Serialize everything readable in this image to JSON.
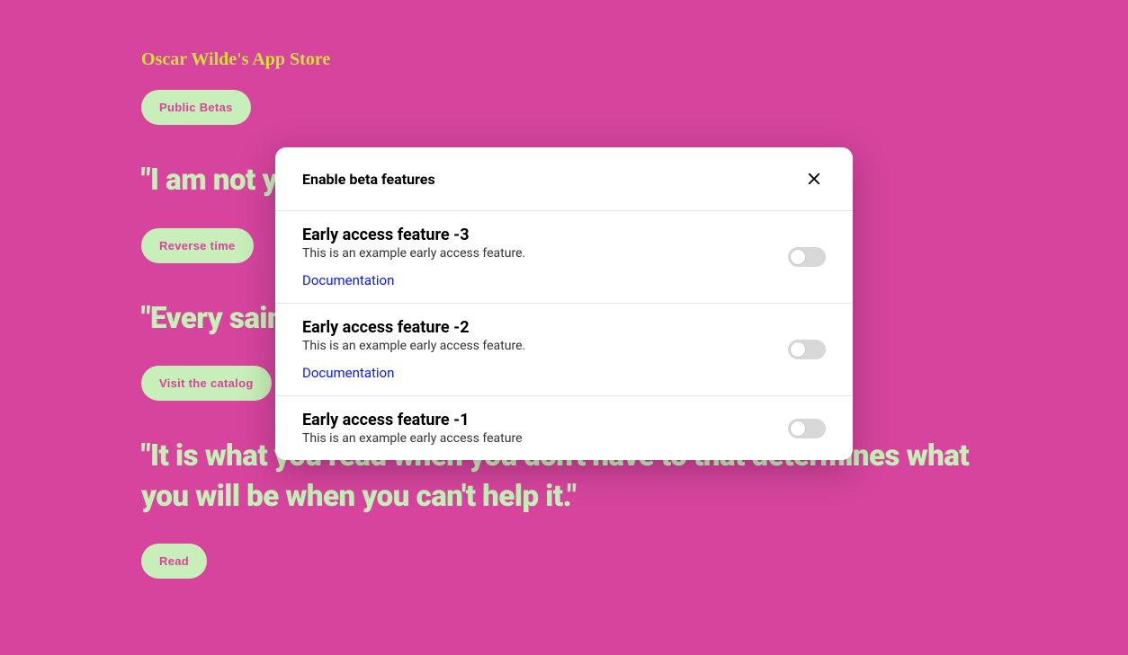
{
  "page": {
    "title": "Oscar Wilde's App Store",
    "buttons": {
      "public_betas": "Public Betas",
      "reverse_time": "Reverse time",
      "visit_catalog": "Visit the catalog",
      "read": "Read"
    },
    "quotes": {
      "q1": "\"I am not young enough to know everything.\"",
      "q2": "\"Every saint has a past, and every sinner has a future.\"",
      "q3": "\"It is what you read when you don't have to that determines what you will be when you can't help it.\""
    }
  },
  "modal": {
    "title": "Enable beta features",
    "features": [
      {
        "title": "Early access feature -3",
        "desc": "This is an example early access feature.",
        "doc": "Documentation"
      },
      {
        "title": "Early access feature -2",
        "desc": "This is an example early access feature.",
        "doc": "Documentation"
      },
      {
        "title": "Early access feature -1",
        "desc": "This is an example early access feature"
      }
    ]
  }
}
